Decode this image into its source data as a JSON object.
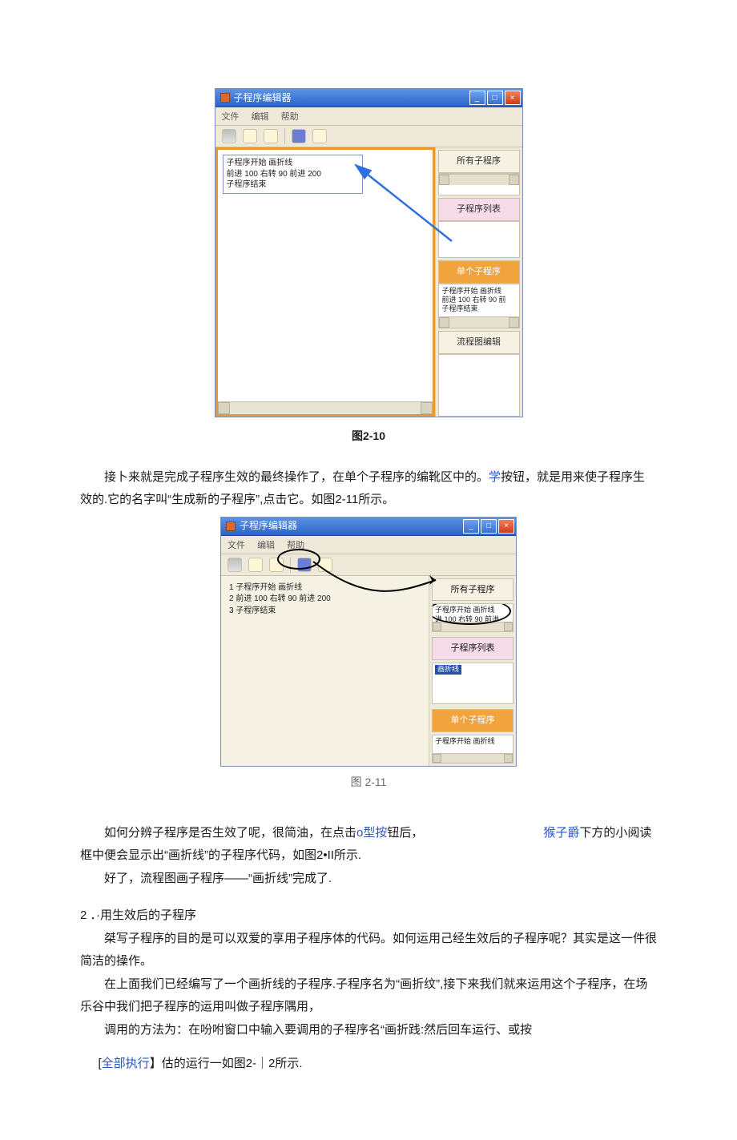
{
  "fig1": {
    "title": "子程序编辑器",
    "menu": {
      "file": "文件",
      "edit": "编辑",
      "help": "帮助"
    },
    "code": {
      "l1": "子程序开始 画折线",
      "l2": "前进 100 右转 90 前进 200",
      "l3": "子程序结束"
    },
    "right": {
      "all": "所有子程序",
      "list": "子程序列表",
      "single": "单个子程序",
      "preview": "子程序开始 画折线\n前进 100 右转 90 前\n子程序结束",
      "flow": "流程图编辑"
    },
    "caption": "图2-10"
  },
  "para1a": "接卜来就是完成子程序生效的最终操作了，在单个子程序的编靴区中的。",
  "para1_link": "学",
  "para1b": "按钮，就是用来使子程序生效的.它的名字叫“生成新的子程序”,点击它。如图2-11所示。",
  "fig2": {
    "title": "子程序编辑器",
    "menu": {
      "file": "文件",
      "edit": "编辑",
      "help": "帮助"
    },
    "code": {
      "l1": "1 子程序开始 画折线",
      "l2": "2 前进 100 右转 90 前进 200",
      "l3": "3 子程序结束"
    },
    "right": {
      "all": "所有子程序",
      "allcontent": "子程序开始 画折线\n进 100 右转 90 前进",
      "list": "子程序列表",
      "listitem": "画折线",
      "single": "单个子程序",
      "preview": "子程序开始 画折线"
    },
    "caption": "图 2-11"
  },
  "para2a": "如何分辨子程序是否生效了呢，很简油，在点击",
  "para2_link1": "o型按",
  "para2b": "钮后，",
  "para2_link2": "猴子爵",
  "para2c": "下方的小阅读框中便会显示出“画折线”的子程序代码，如图2•II所示.",
  "para3": "好了，流程图画子程序——“画折线”完成了.",
  "heading": "2 ．·用生效后的子程序",
  "para4": "桀写子程序的目的是可以双爱的享用子程序体的代码。如何运用己经生效后的子程序呢？其实是这一件很简洁的操作。",
  "para5": "在上面我们已经编写了一个画折线的子程序.子程序名为“画折纹”,接下来我们就来运用这个子程序，在场乐谷中我们把子程序的运用叫做子程序隅用，",
  "para6": "调用的方法为：在吩咐窗口中输入要调用的子程序名“画折践:然后回车运行、或按",
  "para7_pre": "[",
  "para7_link": "全部执行",
  "para7_post": "】估的运行一如图2-｜2所示."
}
